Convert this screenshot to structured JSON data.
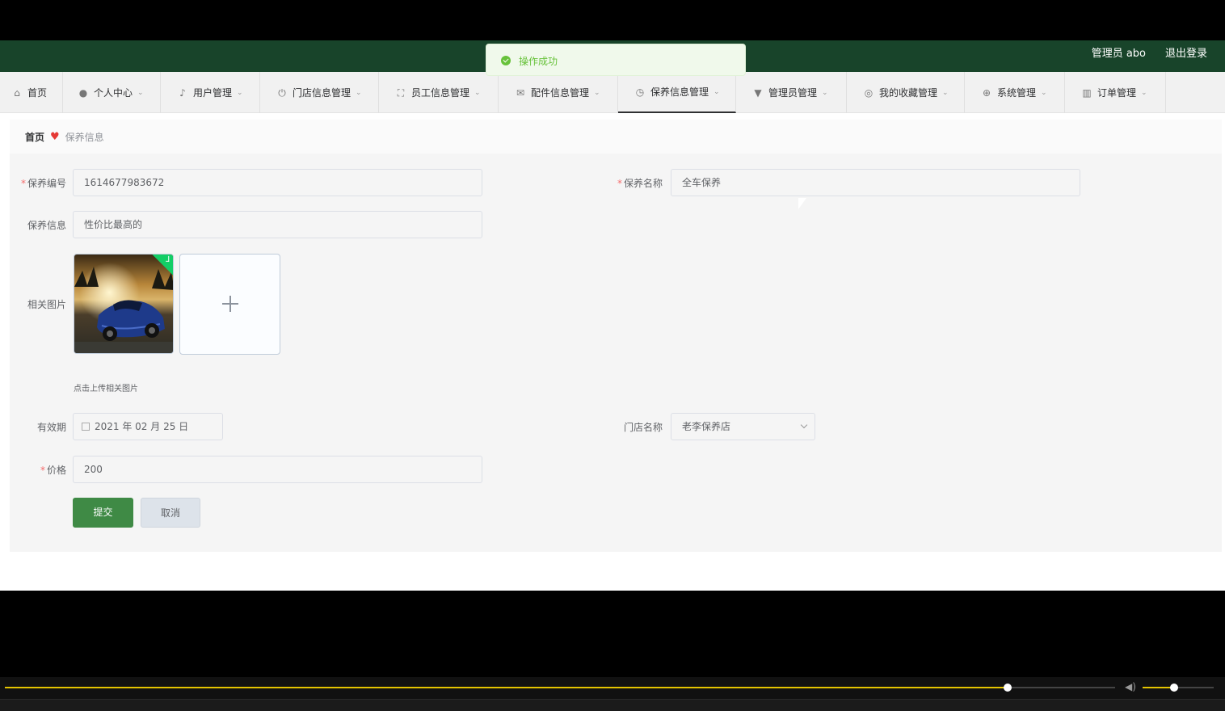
{
  "header": {
    "user": "管理员 abo",
    "logout": "退出登录"
  },
  "toast": {
    "message": "操作成功"
  },
  "nav": {
    "items": [
      {
        "label": "首页",
        "icon": "home-icon"
      },
      {
        "label": "个人中心",
        "icon": "user-icon"
      },
      {
        "label": "用户管理",
        "icon": "bell-off-icon"
      },
      {
        "label": "门店信息管理",
        "icon": "power-icon"
      },
      {
        "label": "员工信息管理",
        "icon": "fullscreen-icon"
      },
      {
        "label": "配件信息管理",
        "icon": "mail-icon"
      },
      {
        "label": "保养信息管理",
        "icon": "clock-icon"
      },
      {
        "label": "管理员管理",
        "icon": "pin-icon"
      },
      {
        "label": "我的收藏管理",
        "icon": "target-icon"
      },
      {
        "label": "系统管理",
        "icon": "crosshair-icon"
      },
      {
        "label": "订单管理",
        "icon": "chart-icon"
      }
    ]
  },
  "breadcrumb": {
    "home": "首页",
    "current": "保养信息"
  },
  "form": {
    "code_label": "保养编号",
    "code_value": "1614677983672",
    "name_label": "保养名称",
    "name_value": "全车保养",
    "info_label": "保养信息",
    "info_value": "性价比最高的",
    "image_label": "相关图片",
    "upload_hint": "点击上传相关图片",
    "valid_label": "有效期",
    "valid_value": "2021 年 02 月 25 日",
    "store_label": "门店名称",
    "store_value": "老李保养店",
    "price_label": "价格",
    "price_value": "200",
    "submit": "提交",
    "cancel": "取消"
  },
  "player": {
    "progress": 0.82,
    "volume": 0.48
  }
}
